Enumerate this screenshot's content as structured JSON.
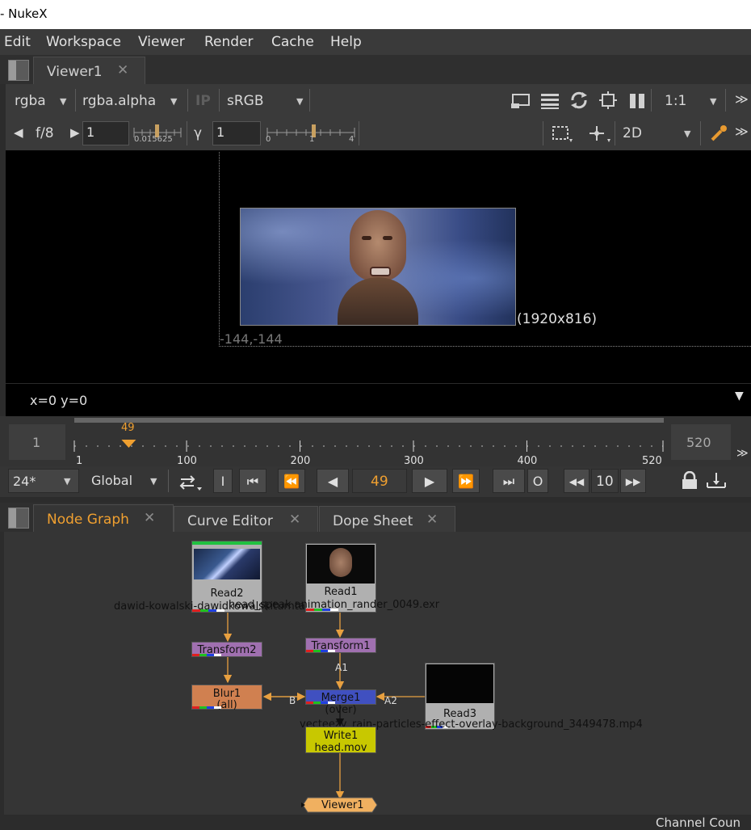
{
  "window": {
    "title": "- NukeX"
  },
  "menu": [
    "Edit",
    "Workspace",
    "Viewer",
    "Render",
    "Cache",
    "Help"
  ],
  "viewer_tab": {
    "label": "Viewer1",
    "close": "✕"
  },
  "viewer_toolbar": {
    "channels": "rgba",
    "channel_alpha": "rgba.alpha",
    "ip": "IP",
    "colorspace": "sRGB",
    "zoom": "1:1"
  },
  "viewer_toolbar2": {
    "fstop": "f/8",
    "gain_value": "1",
    "gain_ticks": "0.015625",
    "gamma_symbol": "γ",
    "gamma_value": "1",
    "gamma_ticks": [
      "0",
      "1",
      "4"
    ],
    "view_mode": "2D"
  },
  "viewport": {
    "format": "(1920x816)",
    "origin": "-144,-144",
    "coords": "x=0 y=0"
  },
  "timeline": {
    "in_frame": "1",
    "out_frame": "520",
    "current": "49",
    "labels": [
      "1",
      "100",
      "200",
      "300",
      "400",
      "520"
    ]
  },
  "playback": {
    "fps": "24*",
    "scope": "Global",
    "frame": "49",
    "step": "10",
    "in_btn": "I",
    "out_btn": "O"
  },
  "panel_tabs": [
    {
      "label": "Node Graph",
      "close": "✕"
    },
    {
      "label": "Curve Editor",
      "close": "✕"
    },
    {
      "label": "Dope Sheet",
      "close": "✕"
    }
  ],
  "nodes": {
    "read2": {
      "label": "Read2",
      "caption": "dawid-kowalski-dawidkowalskiturntable00031"
    },
    "read1": {
      "label": "Read1",
      "caption": "head_speak animation_rander_0049.exr"
    },
    "transform2": {
      "label": "Transform2"
    },
    "transform1": {
      "label": "Transform1"
    },
    "blur1": {
      "label": "Blur1",
      "sub": "(all)"
    },
    "merge1": {
      "label": "Merge1 (over)"
    },
    "read3": {
      "label": "Read3",
      "caption": "vecteezy_rain-particles-effect-overlay-background_3449478.mp4"
    },
    "write1": {
      "label": "Write1",
      "sub": "head.mov"
    },
    "viewer1": {
      "label": "Viewer1"
    }
  },
  "edge_labels": {
    "a1": "A1",
    "b": "B",
    "a2": "A2"
  },
  "footer": {
    "text": "Channel Coun"
  },
  "colors": {
    "accent": "#f0a030",
    "read_node": "#b0b0b0",
    "transform_node": "#a070b0",
    "blur_node": "#d08050",
    "merge_node": "#4050c0",
    "write_node": "#c8c800",
    "viewer_node": "#f0b060",
    "edge": "#e8a040"
  },
  "icons": {
    "panel_menu": "pane-menu-icon",
    "lock": "lock-icon",
    "color_picker": "eyedropper-icon",
    "roi": "roi-icon",
    "pause": "pause-icon"
  }
}
